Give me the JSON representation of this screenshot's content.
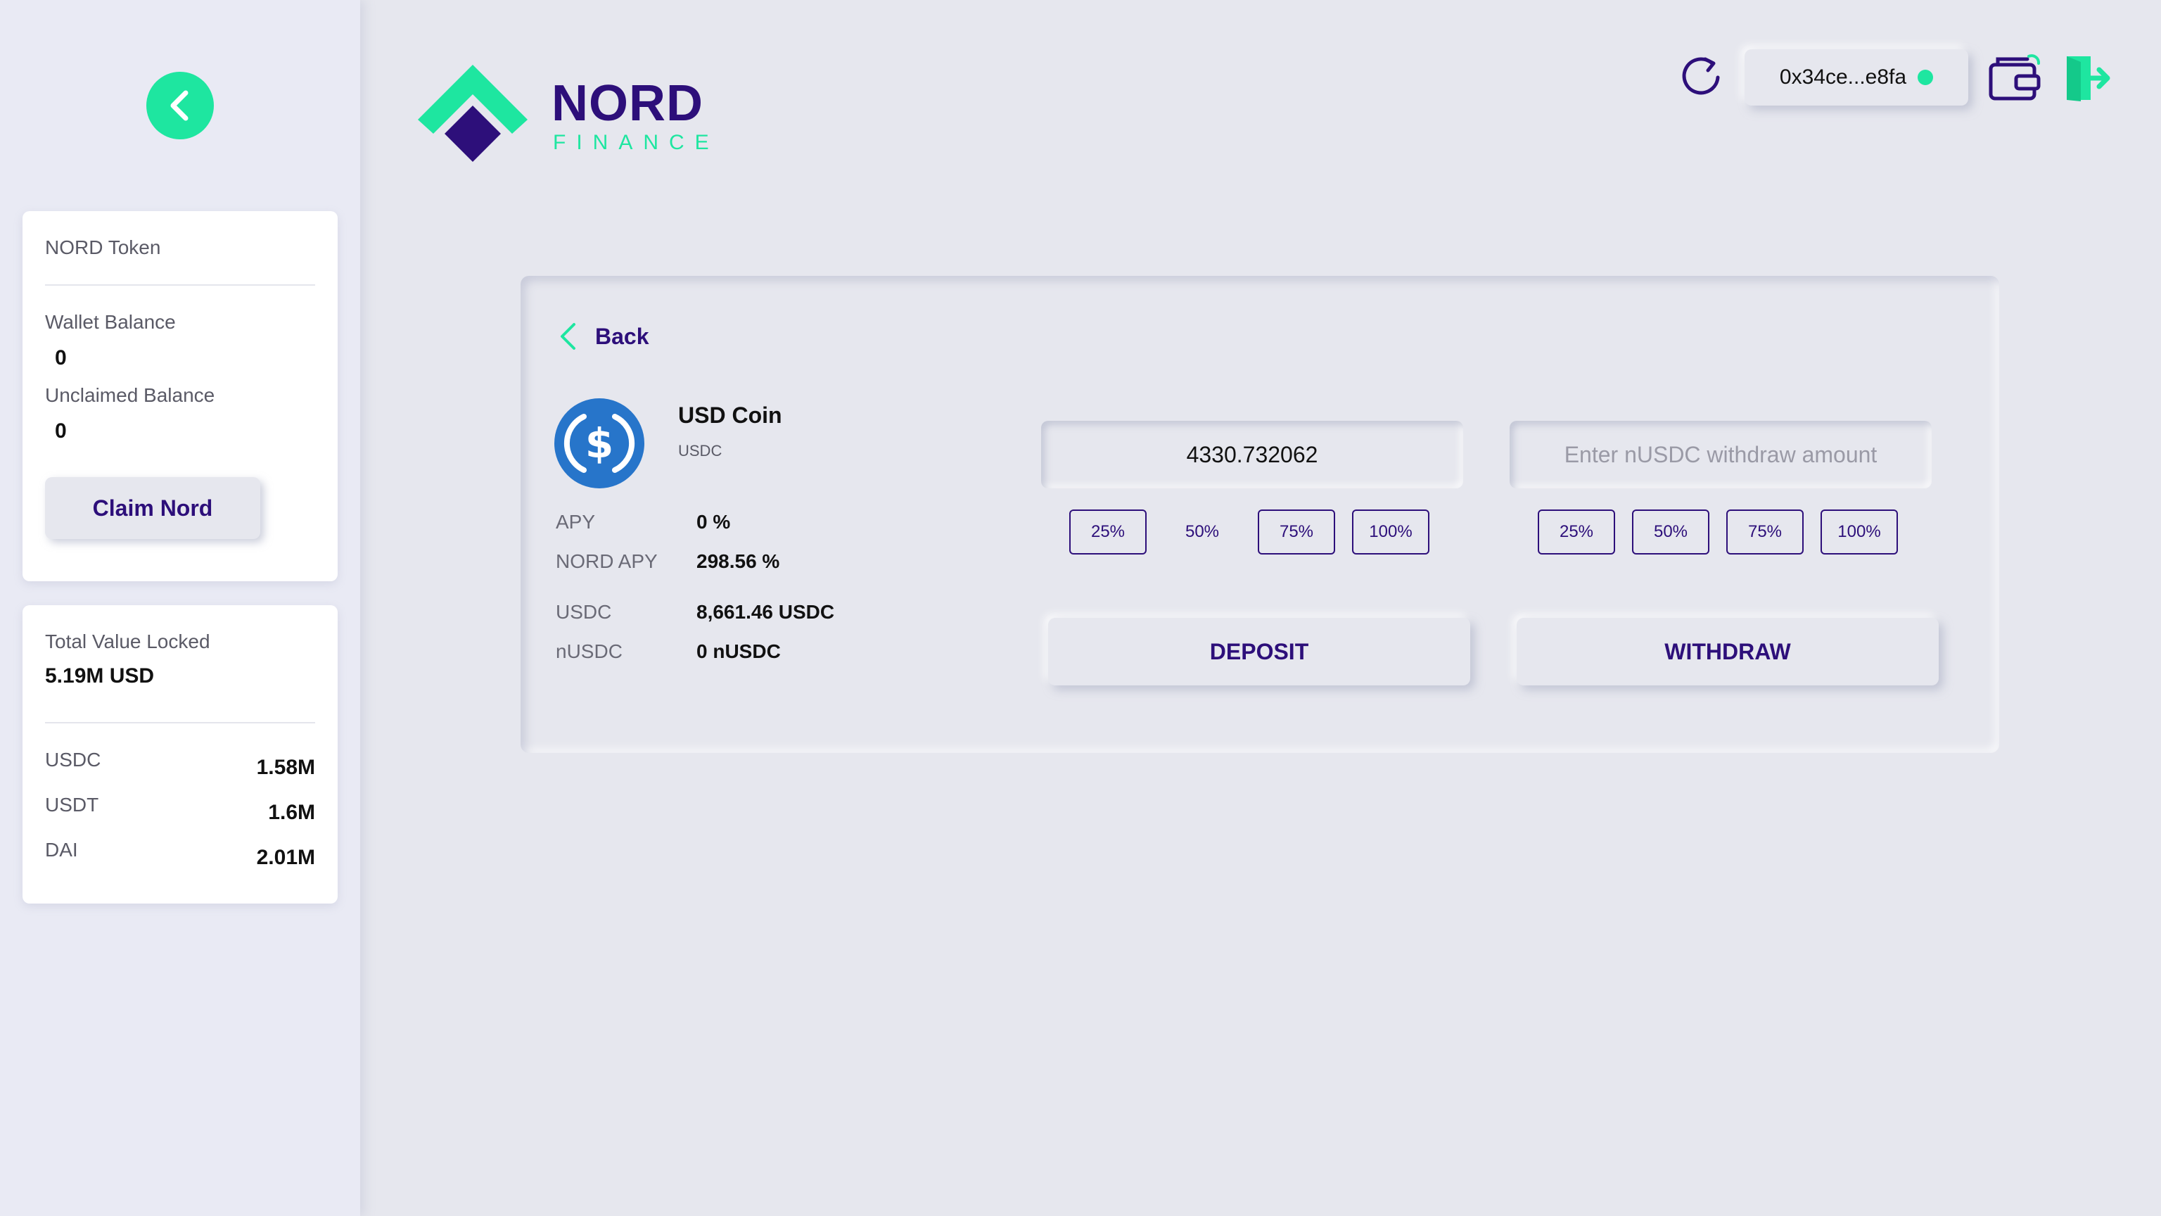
{
  "sidebar": {
    "token_card": {
      "title": "NORD Token",
      "wallet_balance_label": "Wallet Balance",
      "wallet_balance_value": "0",
      "unclaimed_balance_label": "Unclaimed Balance",
      "unclaimed_balance_value": "0",
      "claim_button": "Claim Nord"
    },
    "tvl_card": {
      "title": "Total Value Locked",
      "total": "5.19M USD",
      "items": [
        {
          "label": "USDC",
          "value": "1.58M"
        },
        {
          "label": "USDT",
          "value": "1.6M"
        },
        {
          "label": "DAI",
          "value": "2.01M"
        }
      ]
    }
  },
  "header": {
    "logo_word": "NORD",
    "logo_sub": "FINANCE",
    "wallet_address": "0x34ce...e8fa"
  },
  "panel": {
    "back_label": "Back",
    "coin": {
      "name": "USD Coin",
      "symbol": "USDC"
    },
    "stats": [
      {
        "label": "APY",
        "value": "0 %"
      },
      {
        "label": "NORD APY",
        "value": "298.56 %"
      },
      {
        "label": "USDC",
        "value": "8,661.46 USDC"
      },
      {
        "label": "nUSDC",
        "value": "0 nUSDC"
      }
    ],
    "deposit": {
      "value": "4330.732062",
      "percent_buttons": [
        "25%",
        "50%",
        "75%",
        "100%"
      ],
      "button": "DEPOSIT"
    },
    "withdraw": {
      "placeholder": "Enter nUSDC withdraw amount",
      "percent_buttons": [
        "25%",
        "50%",
        "75%",
        "100%"
      ],
      "button": "WITHDRAW"
    }
  },
  "colors": {
    "accent": "#1ee6a0",
    "brand": "#2d0f7a",
    "coin": "#2775ca",
    "background": "#e6e7ee"
  },
  "icons": [
    "chevron-left-icon",
    "refresh-icon",
    "wallet-icon",
    "logout-icon",
    "usdc-coin-icon"
  ]
}
